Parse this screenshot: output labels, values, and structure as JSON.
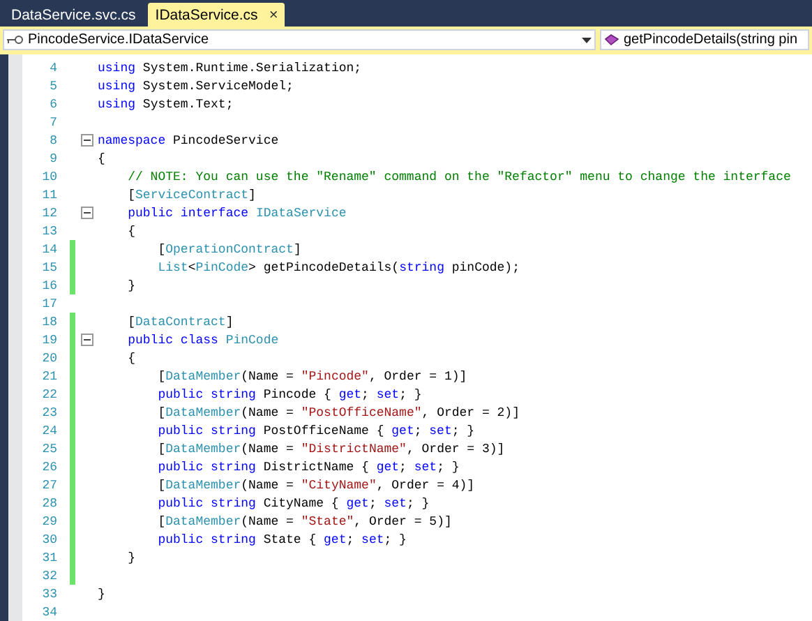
{
  "tabs": [
    {
      "label": "DataService.svc.cs",
      "selected": false
    },
    {
      "label": "IDataService.cs",
      "selected": true,
      "close": "×"
    }
  ],
  "navigation": {
    "type_dropdown": "PincodeService.IDataService",
    "member_dropdown": "getPincodeDetails(string pin"
  },
  "lines": [
    {
      "number": "4",
      "changed": false,
      "fold": false,
      "tokens": [
        {
          "kind": "kw",
          "text": "using"
        },
        {
          "kind": "plain",
          "text": " System.Runtime.Serialization;"
        }
      ]
    },
    {
      "number": "5",
      "changed": false,
      "fold": false,
      "tokens": [
        {
          "kind": "kw",
          "text": "using"
        },
        {
          "kind": "plain",
          "text": " System.ServiceModel;"
        }
      ]
    },
    {
      "number": "6",
      "changed": false,
      "fold": false,
      "tokens": [
        {
          "kind": "kw",
          "text": "using"
        },
        {
          "kind": "plain",
          "text": " System.Text;"
        }
      ]
    },
    {
      "number": "7",
      "changed": false,
      "fold": false
    },
    {
      "number": "8",
      "changed": false,
      "fold": true,
      "tokens": [
        {
          "kind": "kw",
          "text": "namespace"
        },
        {
          "kind": "plain",
          "text": " PincodeService"
        }
      ]
    },
    {
      "number": "9",
      "changed": false,
      "fold": false,
      "tokens": [
        {
          "kind": "plain",
          "text": "{"
        }
      ]
    },
    {
      "number": "10",
      "changed": false,
      "fold": false,
      "tokens": [
        {
          "kind": "comment",
          "text": "    // NOTE: You can use the \"Rename\" command on the \"Refactor\" menu to change the interface"
        }
      ]
    },
    {
      "number": "11",
      "changed": false,
      "fold": false,
      "tokens": [
        {
          "kind": "plain",
          "text": "    ["
        },
        {
          "kind": "type",
          "text": "ServiceContract"
        },
        {
          "kind": "plain",
          "text": "]"
        }
      ]
    },
    {
      "number": "12",
      "changed": false,
      "fold": true,
      "tokens": [
        {
          "kind": "kw",
          "text": "    public "
        },
        {
          "kind": "kw",
          "text": "interface "
        },
        {
          "kind": "type",
          "text": "IDataService"
        }
      ]
    },
    {
      "number": "13",
      "changed": false,
      "fold": false,
      "tokens": [
        {
          "kind": "plain",
          "text": "    {"
        }
      ]
    },
    {
      "number": "14",
      "changed": true,
      "fold": false,
      "tokens": [
        {
          "kind": "plain",
          "text": "        ["
        },
        {
          "kind": "type",
          "text": "OperationContract"
        },
        {
          "kind": "plain",
          "text": "]"
        }
      ]
    },
    {
      "number": "15",
      "changed": true,
      "fold": false,
      "tokens": [
        {
          "kind": "type",
          "text": "        List"
        },
        {
          "kind": "plain",
          "text": "<"
        },
        {
          "kind": "type",
          "text": "PinCode"
        },
        {
          "kind": "plain",
          "text": "> getPincodeDetails("
        },
        {
          "kind": "kw",
          "text": "string"
        },
        {
          "kind": "plain",
          "text": " pinCode);"
        }
      ]
    },
    {
      "number": "16",
      "changed": true,
      "fold": false,
      "tokens": [
        {
          "kind": "plain",
          "text": "    }"
        }
      ]
    },
    {
      "number": "17",
      "changed": false,
      "fold": false
    },
    {
      "number": "18",
      "changed": true,
      "fold": false,
      "tokens": [
        {
          "kind": "plain",
          "text": "    ["
        },
        {
          "kind": "type",
          "text": "DataContract"
        },
        {
          "kind": "plain",
          "text": "]"
        }
      ]
    },
    {
      "number": "19",
      "changed": true,
      "fold": true,
      "tokens": [
        {
          "kind": "kw",
          "text": "    public "
        },
        {
          "kind": "kw",
          "text": "class "
        },
        {
          "kind": "type",
          "text": "PinCode"
        }
      ]
    },
    {
      "number": "20",
      "changed": true,
      "fold": false,
      "tokens": [
        {
          "kind": "plain",
          "text": "    {"
        }
      ]
    },
    {
      "number": "21",
      "changed": true,
      "fold": false,
      "tokens": [
        {
          "kind": "plain",
          "text": "        ["
        },
        {
          "kind": "type",
          "text": "DataMember"
        },
        {
          "kind": "plain",
          "text": "(Name = "
        },
        {
          "kind": "string",
          "text": "\"Pincode\""
        },
        {
          "kind": "plain",
          "text": ", Order = 1)]"
        }
      ]
    },
    {
      "number": "22",
      "changed": true,
      "fold": false,
      "tokens": [
        {
          "kind": "kw",
          "text": "        public string"
        },
        {
          "kind": "plain",
          "text": " Pincode { "
        },
        {
          "kind": "kw",
          "text": "get"
        },
        {
          "kind": "plain",
          "text": "; "
        },
        {
          "kind": "kw",
          "text": "set"
        },
        {
          "kind": "plain",
          "text": "; }"
        }
      ]
    },
    {
      "number": "23",
      "changed": true,
      "fold": false,
      "tokens": [
        {
          "kind": "plain",
          "text": "        ["
        },
        {
          "kind": "type",
          "text": "DataMember"
        },
        {
          "kind": "plain",
          "text": "(Name = "
        },
        {
          "kind": "string",
          "text": "\"PostOfficeName\""
        },
        {
          "kind": "plain",
          "text": ", Order = 2)]"
        }
      ]
    },
    {
      "number": "24",
      "changed": true,
      "fold": false,
      "tokens": [
        {
          "kind": "kw",
          "text": "        public string"
        },
        {
          "kind": "plain",
          "text": " PostOfficeName { "
        },
        {
          "kind": "kw",
          "text": "get"
        },
        {
          "kind": "plain",
          "text": "; "
        },
        {
          "kind": "kw",
          "text": "set"
        },
        {
          "kind": "plain",
          "text": "; }"
        }
      ]
    },
    {
      "number": "25",
      "changed": true,
      "fold": false,
      "tokens": [
        {
          "kind": "plain",
          "text": "        ["
        },
        {
          "kind": "type",
          "text": "DataMember"
        },
        {
          "kind": "plain",
          "text": "(Name = "
        },
        {
          "kind": "string",
          "text": "\"DistrictName\""
        },
        {
          "kind": "plain",
          "text": ", Order = 3)]"
        }
      ]
    },
    {
      "number": "26",
      "changed": true,
      "fold": false,
      "tokens": [
        {
          "kind": "kw",
          "text": "        public string"
        },
        {
          "kind": "plain",
          "text": " DistrictName { "
        },
        {
          "kind": "kw",
          "text": "get"
        },
        {
          "kind": "plain",
          "text": "; "
        },
        {
          "kind": "kw",
          "text": "set"
        },
        {
          "kind": "plain",
          "text": "; }"
        }
      ]
    },
    {
      "number": "27",
      "changed": true,
      "fold": false,
      "tokens": [
        {
          "kind": "plain",
          "text": "        ["
        },
        {
          "kind": "type",
          "text": "DataMember"
        },
        {
          "kind": "plain",
          "text": "(Name = "
        },
        {
          "kind": "string",
          "text": "\"CityName\""
        },
        {
          "kind": "plain",
          "text": ", Order = 4)]"
        }
      ]
    },
    {
      "number": "28",
      "changed": true,
      "fold": false,
      "tokens": [
        {
          "kind": "kw",
          "text": "        public string"
        },
        {
          "kind": "plain",
          "text": " CityName { "
        },
        {
          "kind": "kw",
          "text": "get"
        },
        {
          "kind": "plain",
          "text": "; "
        },
        {
          "kind": "kw",
          "text": "set"
        },
        {
          "kind": "plain",
          "text": "; }"
        }
      ]
    },
    {
      "number": "29",
      "changed": true,
      "fold": false,
      "tokens": [
        {
          "kind": "plain",
          "text": "        ["
        },
        {
          "kind": "type",
          "text": "DataMember"
        },
        {
          "kind": "plain",
          "text": "(Name = "
        },
        {
          "kind": "string",
          "text": "\"State\""
        },
        {
          "kind": "plain",
          "text": ", Order = 5)]"
        }
      ]
    },
    {
      "number": "30",
      "changed": true,
      "fold": false,
      "tokens": [
        {
          "kind": "kw",
          "text": "        public string"
        },
        {
          "kind": "plain",
          "text": " State { "
        },
        {
          "kind": "kw",
          "text": "get"
        },
        {
          "kind": "plain",
          "text": "; "
        },
        {
          "kind": "kw",
          "text": "set"
        },
        {
          "kind": "plain",
          "text": "; }"
        }
      ]
    },
    {
      "number": "31",
      "changed": true,
      "fold": false,
      "tokens": [
        {
          "kind": "plain",
          "text": "    }"
        }
      ]
    },
    {
      "number": "32",
      "changed": true,
      "fold": false
    },
    {
      "number": "33",
      "changed": false,
      "fold": false,
      "tokens": [
        {
          "kind": "plain",
          "text": "}"
        }
      ]
    },
    {
      "number": "34",
      "changed": false,
      "fold": false
    }
  ]
}
